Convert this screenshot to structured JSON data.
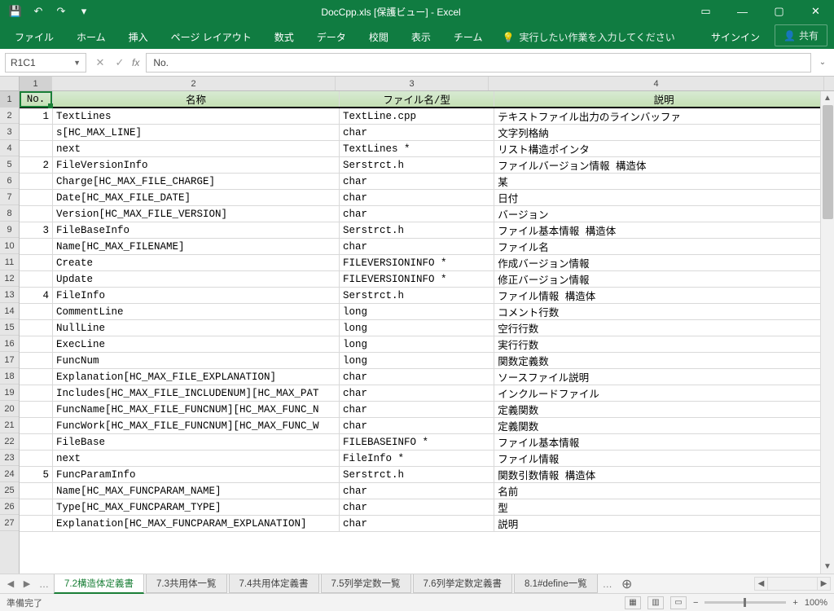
{
  "title": "DocCpp.xls [保護ビュー] - Excel",
  "qat": {
    "save": "💾",
    "undo": "↶",
    "redo": "↷",
    "more": "▾"
  },
  "winctrl": {
    "ribbonopt": "▭",
    "min": "—",
    "max": "▢",
    "close": "✕"
  },
  "ribbon": {
    "tabs": [
      "ファイル",
      "ホーム",
      "挿入",
      "ページ レイアウト",
      "数式",
      "データ",
      "校閲",
      "表示",
      "チーム"
    ],
    "tellme": "実行したい作業を入力してください",
    "signin": "サインイン",
    "share": "共有"
  },
  "namebox": "R1C1",
  "formula": "No.",
  "colnums": [
    "1",
    "2",
    "3",
    "4"
  ],
  "header": {
    "no": "No.",
    "name": "名称",
    "file": "ファイル名/型",
    "desc": "説明"
  },
  "rows": [
    {
      "no": "1",
      "name": "TextLines",
      "file": "TextLine.cpp",
      "desc": "テキストファイル出力のラインバッファ"
    },
    {
      "no": "",
      "name": "s[HC_MAX_LINE]",
      "file": "char",
      "desc": "文字列格納"
    },
    {
      "no": "",
      "name": "next",
      "file": "TextLines *",
      "desc": "リスト構造ポインタ"
    },
    {
      "no": "2",
      "name": "FileVersionInfo",
      "file": "Serstrct.h",
      "desc": "ファイルバージョン情報 構造体"
    },
    {
      "no": "",
      "name": "Charge[HC_MAX_FILE_CHARGE]",
      "file": "char",
      "desc": "某"
    },
    {
      "no": "",
      "name": "Date[HC_MAX_FILE_DATE]",
      "file": "char",
      "desc": "日付"
    },
    {
      "no": "",
      "name": "Version[HC_MAX_FILE_VERSION]",
      "file": "char",
      "desc": "バージョン"
    },
    {
      "no": "3",
      "name": "FileBaseInfo",
      "file": "Serstrct.h",
      "desc": "ファイル基本情報 構造体"
    },
    {
      "no": "",
      "name": "Name[HC_MAX_FILENAME]",
      "file": "char",
      "desc": "ファイル名"
    },
    {
      "no": "",
      "name": "Create",
      "file": "FILEVERSIONINFO *",
      "desc": "作成バージョン情報"
    },
    {
      "no": "",
      "name": "Update",
      "file": "FILEVERSIONINFO *",
      "desc": "修正バージョン情報"
    },
    {
      "no": "4",
      "name": "FileInfo",
      "file": "Serstrct.h",
      "desc": "ファイル情報 構造体"
    },
    {
      "no": "",
      "name": "CommentLine",
      "file": "long",
      "desc": "コメント行数"
    },
    {
      "no": "",
      "name": "NullLine",
      "file": "long",
      "desc": "空行行数"
    },
    {
      "no": "",
      "name": "ExecLine",
      "file": "long",
      "desc": "実行行数"
    },
    {
      "no": "",
      "name": "FuncNum",
      "file": "long",
      "desc": "関数定義数"
    },
    {
      "no": "",
      "name": "Explanation[HC_MAX_FILE_EXPLANATION]",
      "file": "char",
      "desc": "ソースファイル説明"
    },
    {
      "no": "",
      "name": "Includes[HC_MAX_FILE_INCLUDENUM][HC_MAX_PAT",
      "file": "char",
      "desc": "インクルードファイル"
    },
    {
      "no": "",
      "name": "FuncName[HC_MAX_FILE_FUNCNUM][HC_MAX_FUNC_N",
      "file": "char",
      "desc": "定義関数"
    },
    {
      "no": "",
      "name": "FuncWork[HC_MAX_FILE_FUNCNUM][HC_MAX_FUNC_W",
      "file": "char",
      "desc": "定義関数"
    },
    {
      "no": "",
      "name": "FileBase",
      "file": "FILEBASEINFO *",
      "desc": "ファイル基本情報"
    },
    {
      "no": "",
      "name": "next",
      "file": "FileInfo *",
      "desc": "ファイル情報"
    },
    {
      "no": "5",
      "name": "FuncParamInfo",
      "file": "Serstrct.h",
      "desc": "関数引数情報 構造体"
    },
    {
      "no": "",
      "name": "Name[HC_MAX_FUNCPARAM_NAME]",
      "file": "char",
      "desc": "名前"
    },
    {
      "no": "",
      "name": "Type[HC_MAX_FUNCPARAM_TYPE]",
      "file": "char",
      "desc": "型"
    },
    {
      "no": "",
      "name": "Explanation[HC_MAX_FUNCPARAM_EXPLANATION]",
      "file": "char",
      "desc": "説明"
    }
  ],
  "sheets": [
    "7.2構造体定義書",
    "7.3共用体一覧",
    "7.4共用体定義書",
    "7.5列挙定数一覧",
    "7.6列挙定数定義書",
    "8.1#define一覧"
  ],
  "activesheet": 0,
  "status": {
    "ready": "準備完了",
    "zoom": "100%"
  }
}
